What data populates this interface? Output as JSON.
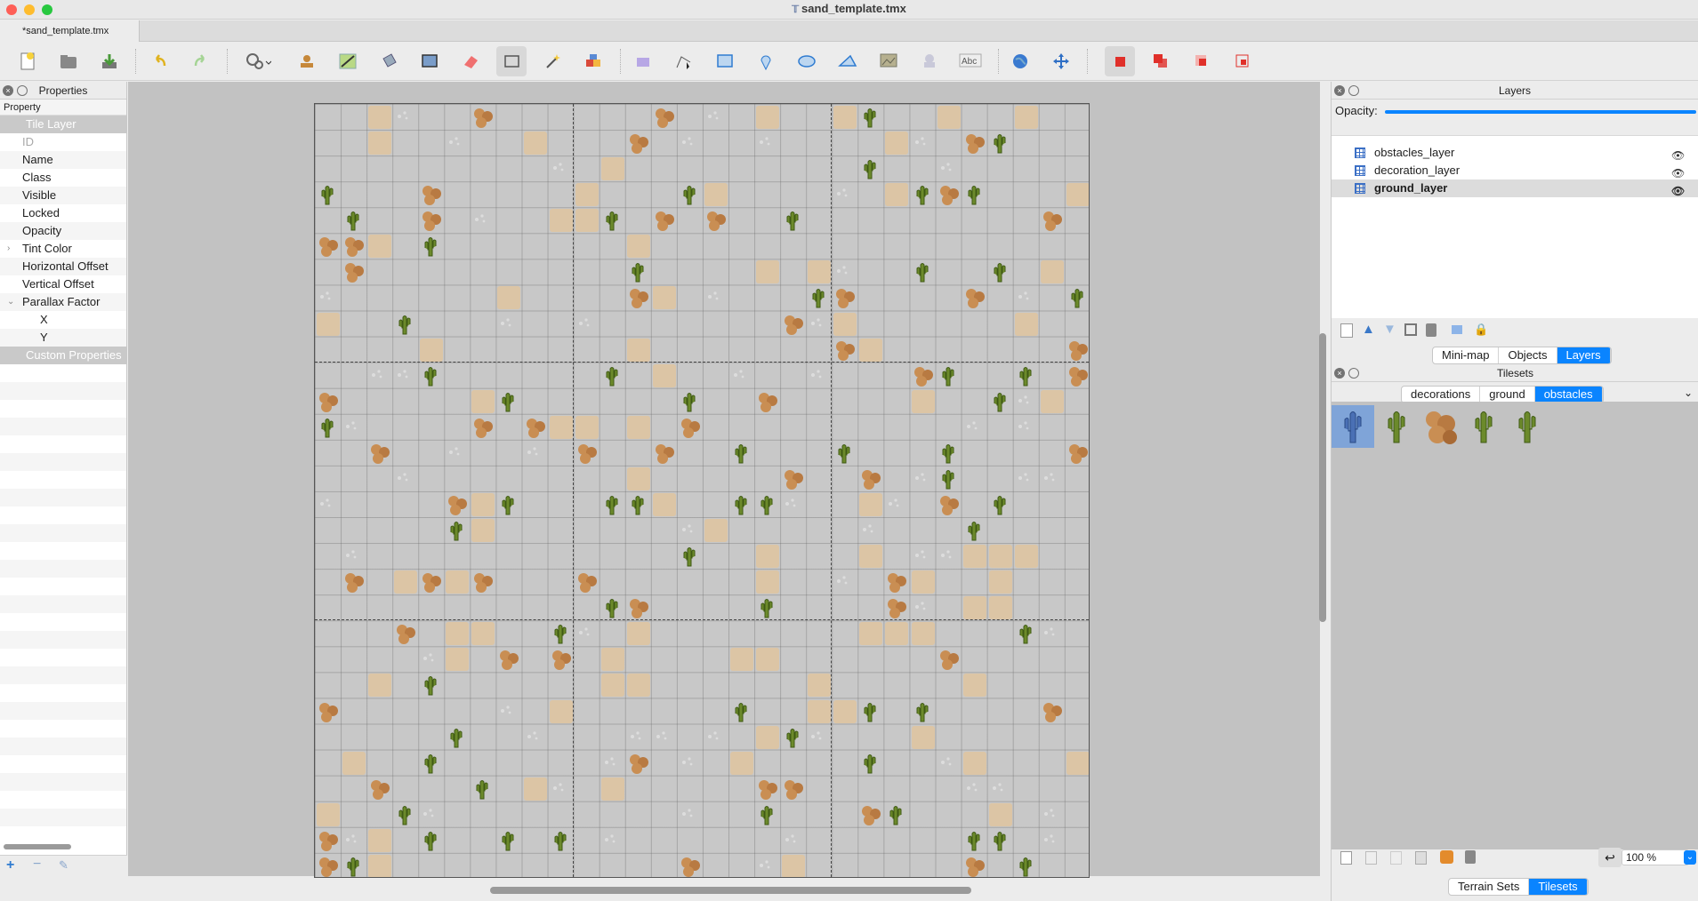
{
  "window": {
    "title": "sand_template.tmx"
  },
  "tabs": [
    {
      "label": "*sand_template.tmx"
    }
  ],
  "properties": {
    "panel_title": "Properties",
    "column_header": "Property",
    "group_tile_layer": "Tile Layer",
    "rows": {
      "id": "ID",
      "name": "Name",
      "class": "Class",
      "visible": "Visible",
      "locked": "Locked",
      "opacity": "Opacity",
      "tint_color": "Tint Color",
      "horizontal_offset": "Horizontal Offset",
      "vertical_offset": "Vertical Offset",
      "parallax_factor": "Parallax Factor",
      "x": "X",
      "y": "Y"
    },
    "group_custom": "Custom Properties"
  },
  "layers_panel": {
    "title": "Layers",
    "opacity_label": "Opacity:",
    "opacity_value": 1.0,
    "items": [
      {
        "name": "obstacles_layer",
        "selected": false
      },
      {
        "name": "decoration_layer",
        "selected": false
      },
      {
        "name": "ground_layer",
        "selected": true
      }
    ],
    "view_tabs": [
      "Mini-map",
      "Objects",
      "Layers"
    ],
    "active_view_tab": "Layers"
  },
  "tilesets_panel": {
    "title": "Tilesets",
    "tabs": [
      "decorations",
      "ground",
      "obstacles"
    ],
    "active_tab": "obstacles",
    "zoom": "100 %"
  },
  "bottom_tabs": [
    "Terrain Sets",
    "Tilesets"
  ],
  "active_bottom_tab": "Tilesets",
  "colors": {
    "accent": "#0a84ff",
    "canvas_bg": "#c2c2c2",
    "group_row": "#c9c9c9"
  }
}
